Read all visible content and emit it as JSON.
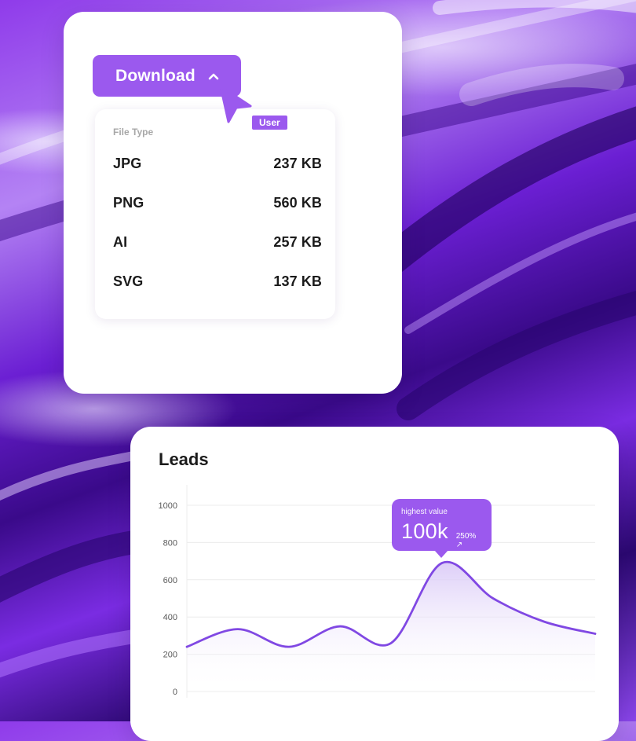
{
  "download_menu": {
    "button_label": "Download",
    "user_tag": "User",
    "title": "File Type",
    "items": [
      {
        "type": "JPG",
        "size": "237 KB"
      },
      {
        "type": "PNG",
        "size": "560 KB"
      },
      {
        "type": "AI",
        "size": "257 KB"
      },
      {
        "type": "SVG",
        "size": "137 KB"
      }
    ]
  },
  "tooltip": {
    "label": "highest value",
    "value": "100k",
    "change": "250%"
  },
  "colors": {
    "accent": "#9b59ee",
    "line": "#8048e3",
    "fill_top": "#d9c8f7"
  },
  "chart_data": {
    "type": "area",
    "title": "Leads",
    "xlabel": "",
    "ylabel": "",
    "ylim": [
      0,
      1000
    ],
    "yticks": [
      0,
      200,
      400,
      600,
      800,
      1000
    ],
    "grid": true,
    "x": [
      0,
      1,
      2,
      3,
      4,
      5,
      6,
      7,
      8,
      9,
      10
    ],
    "values": [
      240,
      335,
      240,
      350,
      260,
      690,
      500,
      375,
      310
    ]
  }
}
